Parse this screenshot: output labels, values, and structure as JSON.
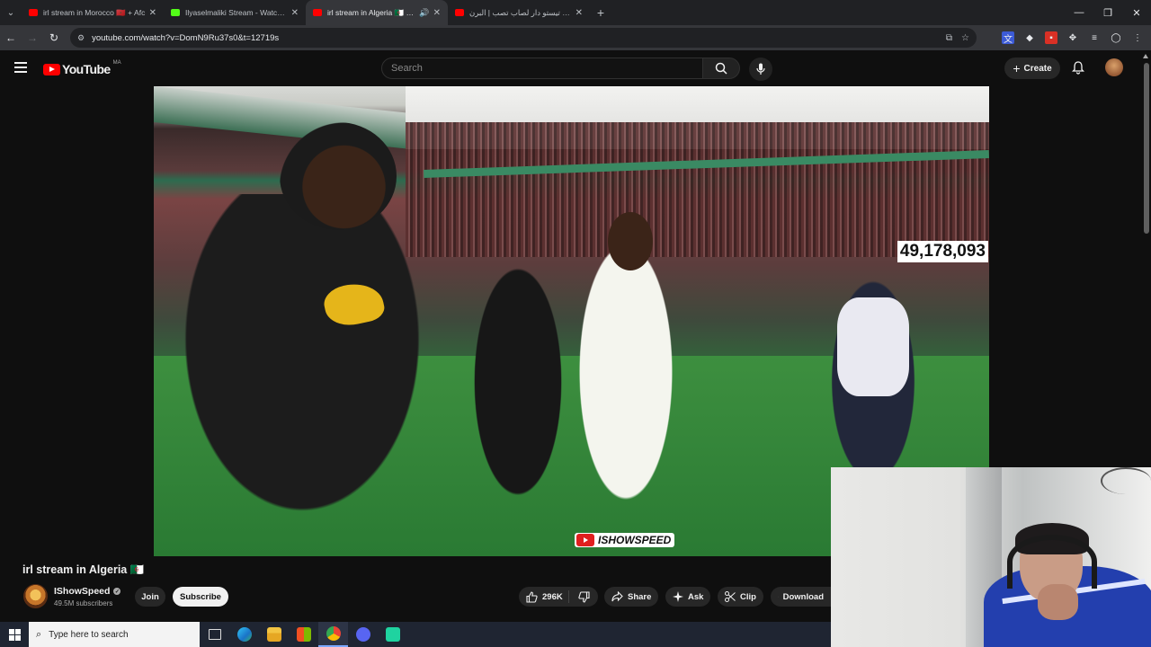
{
  "browser": {
    "tabs": [
      {
        "title": "irl stream in Morocco 🇲🇦 + Afc",
        "favicon_color": "#ff0000"
      },
      {
        "title": "Ilyaselmaliki Stream - Watch Li",
        "favicon_color": "#53fc18"
      },
      {
        "title": "irl stream in Algeria 🇩🇿 - Yo",
        "favicon_color": "#ff0000"
      },
      {
        "title": "عمر تيستو دار لصاب تصب | البرن",
        "favicon_color": "#ff0000"
      }
    ],
    "url": "youtube.com/watch?v=DomN9Ru37s0&t=12719s"
  },
  "youtube": {
    "logo_text": "YouTube",
    "country_code": "MA",
    "search_placeholder": "Search",
    "create_label": "Create"
  },
  "video": {
    "overlay_counter": "49,178,093",
    "watermark": "ISHOWSPEED",
    "title": "irl stream in Algeria 🇩🇿",
    "channel_name": "IShowSpeed",
    "subscribers": "49.5M subscribers",
    "join_label": "Join",
    "subscribe_label": "Subscribe",
    "likes": "296K",
    "share_label": "Share",
    "ask_label": "Ask",
    "clip_label": "Clip",
    "download_label": "Download"
  },
  "taskbar": {
    "search_placeholder": "Type here to search",
    "apps": [
      "task-view",
      "edge",
      "file-explorer",
      "store",
      "chrome",
      "discord",
      "app"
    ]
  },
  "colors": {
    "youtube_red": "#ff0000",
    "background": "#0f0f0f",
    "chrome_dark": "#202124"
  }
}
